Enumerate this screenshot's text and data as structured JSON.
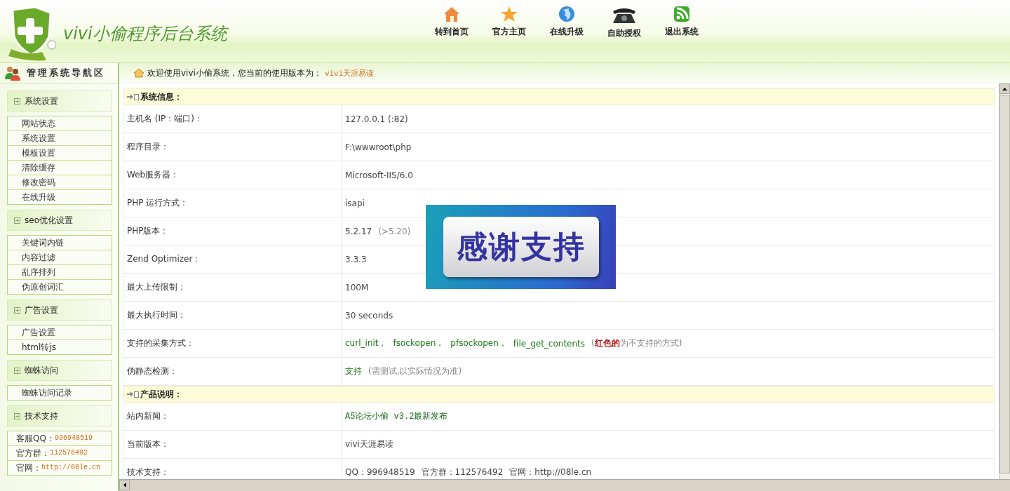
{
  "header": {
    "title": "vivi小偷程序后台系统",
    "nav": [
      {
        "label": "转到首页",
        "kind": "house"
      },
      {
        "label": "官方主页",
        "kind": "star"
      },
      {
        "label": "在线升级",
        "kind": "globe"
      },
      {
        "label": "自助授权",
        "kind": "phone"
      },
      {
        "label": "退出系统",
        "kind": "feed"
      }
    ]
  },
  "sidebar": {
    "title": "管理系统导航区",
    "groups": [
      {
        "title": "系统设置",
        "items": [
          {
            "text": "网站状态"
          },
          {
            "text": "系统设置"
          },
          {
            "text": "模板设置"
          },
          {
            "text": "清除缓存"
          },
          {
            "text": "修改密码"
          },
          {
            "text": "在线升级"
          }
        ]
      },
      {
        "title": "seo优化设置",
        "items": [
          {
            "text": "关键词内链"
          },
          {
            "text": "内容过滤"
          },
          {
            "text": "乱序排列"
          },
          {
            "text": "伪原创词汇"
          }
        ]
      },
      {
        "title": "广告设置",
        "items": [
          {
            "text": "广告设置"
          },
          {
            "text": "html转js"
          }
        ]
      },
      {
        "title": "蜘蛛访问",
        "items": [
          {
            "text": "蜘蛛访问记录"
          }
        ]
      },
      {
        "title": "技术支持",
        "items": [
          {
            "text": "客服QQ：",
            "value": "996948519"
          },
          {
            "text": "官方群：",
            "value": "112576492"
          },
          {
            "text": "官网：",
            "value": "http://08le.cn"
          }
        ]
      }
    ]
  },
  "welcome": {
    "text": "欢迎使用vivi小偷系统，您当前的使用版本为：",
    "version": "vivi天涯易读"
  },
  "sections": [
    {
      "title": "系统信息：",
      "rows": [
        {
          "label": "主机名 (IP：端口)：",
          "parts": [
            {
              "text": "127.0.0.1  (:82)",
              "kind": "plain"
            }
          ]
        },
        {
          "label": "程序目录：",
          "parts": [
            {
              "text": "F:\\wwwroot\\php",
              "kind": "plain"
            }
          ]
        },
        {
          "label": "Web服务器：",
          "parts": [
            {
              "text": "Microsoft-IIS/6.0",
              "kind": "plain"
            }
          ]
        },
        {
          "label": "PHP 运行方式：",
          "parts": [
            {
              "text": "isapi",
              "kind": "plain"
            }
          ]
        },
        {
          "label": "PHP版本：",
          "parts": [
            {
              "text": "5.2.17",
              "kind": "plain"
            },
            {
              "text": "(>5.20)",
              "kind": "note"
            }
          ]
        },
        {
          "label": "Zend Optimizer：",
          "parts": [
            {
              "text": "3.3.3",
              "kind": "plain"
            }
          ]
        },
        {
          "label": "最大上传限制：",
          "parts": [
            {
              "text": "100M",
              "kind": "plain"
            }
          ]
        },
        {
          "label": "最大执行时间：",
          "parts": [
            {
              "text": "30 seconds",
              "kind": "plain"
            }
          ]
        },
        {
          "label": "支持的采集方式：",
          "parts": [
            {
              "text": "curl_init，",
              "kind": "ok"
            },
            {
              "text": "fsockopen，",
              "kind": "ok"
            },
            {
              "text": "pfsockopen，",
              "kind": "ok"
            },
            {
              "text": "file_get_contents",
              "kind": "ok"
            },
            {
              "text": "(**红色的**为不支持的方式)",
              "kind": "note"
            }
          ]
        },
        {
          "label": "伪静态检测：",
          "parts": [
            {
              "text": "支持",
              "kind": "ok"
            },
            {
              "text": "(需测试,以实际情况为准)",
              "kind": "note"
            }
          ]
        }
      ]
    },
    {
      "title": "产品说明：",
      "rows": [
        {
          "label": "站内新闻：",
          "parts": [
            {
              "text": "A5论坛小偷 v3.2最新发布",
              "kind": "link"
            }
          ]
        },
        {
          "label": "当前版本：",
          "parts": [
            {
              "text": "vivi天涯易读",
              "kind": "plain"
            }
          ]
        },
        {
          "label": "技术支持：",
          "parts": [
            {
              "text": "QQ：996948519",
              "kind": "plain"
            },
            {
              "text": "官方群：112576492",
              "kind": "plain"
            },
            {
              "text": "官网：http://08le.cn",
              "kind": "plain"
            }
          ]
        }
      ]
    }
  ],
  "overlay": {
    "text": "感谢支持"
  }
}
